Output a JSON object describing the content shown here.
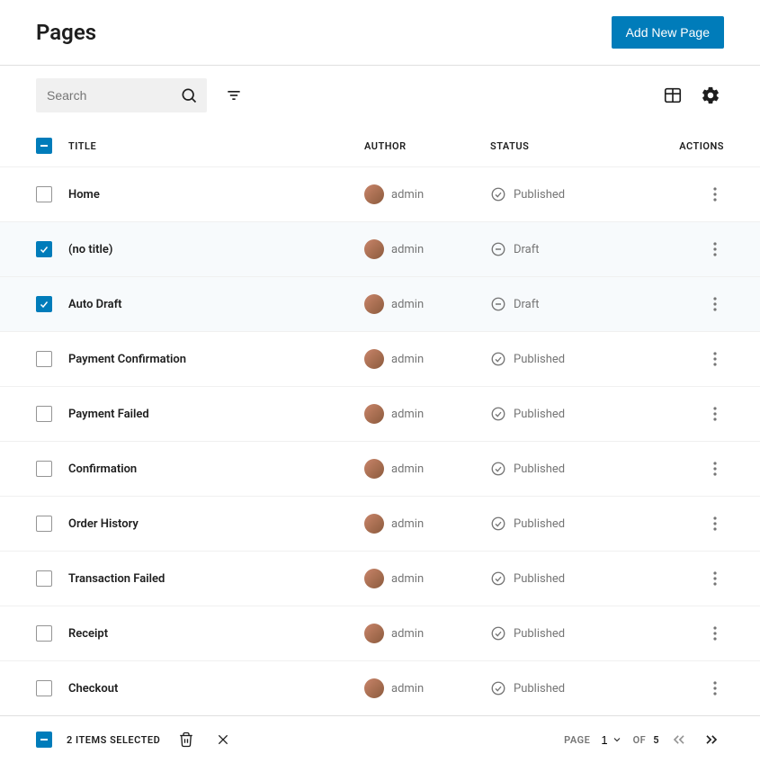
{
  "header": {
    "title": "Pages",
    "add_button": "Add New Page"
  },
  "search": {
    "placeholder": "Search"
  },
  "columns": {
    "title": "Title",
    "author": "Author",
    "status": "Status",
    "actions": "Actions"
  },
  "rows": [
    {
      "title": "Home",
      "author": "admin",
      "status": "Published",
      "status_type": "published",
      "selected": false
    },
    {
      "title": "(no title)",
      "author": "admin",
      "status": "Draft",
      "status_type": "draft",
      "selected": true
    },
    {
      "title": "Auto Draft",
      "author": "admin",
      "status": "Draft",
      "status_type": "draft",
      "selected": true
    },
    {
      "title": "Payment Confirmation",
      "author": "admin",
      "status": "Published",
      "status_type": "published",
      "selected": false
    },
    {
      "title": "Payment Failed",
      "author": "admin",
      "status": "Published",
      "status_type": "published",
      "selected": false
    },
    {
      "title": "Confirmation",
      "author": "admin",
      "status": "Published",
      "status_type": "published",
      "selected": false
    },
    {
      "title": "Order History",
      "author": "admin",
      "status": "Published",
      "status_type": "published",
      "selected": false
    },
    {
      "title": "Transaction Failed",
      "author": "admin",
      "status": "Published",
      "status_type": "published",
      "selected": false
    },
    {
      "title": "Receipt",
      "author": "admin",
      "status": "Published",
      "status_type": "published",
      "selected": false
    },
    {
      "title": "Checkout",
      "author": "admin",
      "status": "Published",
      "status_type": "published",
      "selected": false
    }
  ],
  "footer": {
    "selection_text": "2 ITEMS SELECTED",
    "page_label": "PAGE",
    "current_page": "1",
    "of_label": "OF",
    "total_pages": "5"
  }
}
